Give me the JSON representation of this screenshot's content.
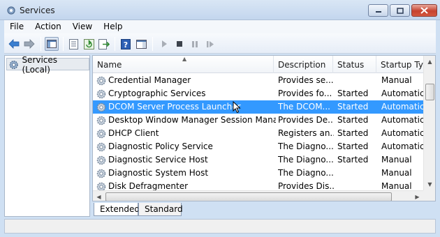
{
  "window": {
    "title": "Services"
  },
  "menu": [
    "File",
    "Action",
    "View",
    "Help"
  ],
  "tree": {
    "root_label": "Services (Local)"
  },
  "table": {
    "columns": [
      "Name",
      "Description",
      "Status",
      "Startup Typ"
    ],
    "rows": [
      {
        "name": "Credential Manager",
        "description": "Provides se...",
        "status": "",
        "startup": "Manual",
        "selected": false
      },
      {
        "name": "Cryptographic Services",
        "description": "Provides fo...",
        "status": "Started",
        "startup": "Automatic",
        "selected": false
      },
      {
        "name": "DCOM Server Process Launcher",
        "description": "The DCOM...",
        "status": "Started",
        "startup": "Automatic",
        "selected": true
      },
      {
        "name": "Desktop Window Manager Session Manager",
        "description": "Provides De...",
        "status": "Started",
        "startup": "Automatic",
        "selected": false
      },
      {
        "name": "DHCP Client",
        "description": "Registers an...",
        "status": "Started",
        "startup": "Automatic",
        "selected": false
      },
      {
        "name": "Diagnostic Policy Service",
        "description": "The Diagno...",
        "status": "Started",
        "startup": "Automatic",
        "selected": false
      },
      {
        "name": "Diagnostic Service Host",
        "description": "The Diagno...",
        "status": "Started",
        "startup": "Manual",
        "selected": false
      },
      {
        "name": "Diagnostic System Host",
        "description": "The Diagno...",
        "status": "",
        "startup": "Manual",
        "selected": false
      },
      {
        "name": "Disk Defragmenter",
        "description": "Provides Dis...",
        "status": "",
        "startup": "Manual",
        "selected": false
      }
    ]
  },
  "tabs": [
    "Extended",
    "Standard"
  ],
  "colors": {
    "selection": "#3399ff",
    "chrome": "#cfe0f3"
  },
  "icons": [
    "services-gear-icon",
    "back-arrow-icon",
    "forward-arrow-icon",
    "console-tree-icon",
    "properties-icon",
    "refresh-icon",
    "export-list-icon",
    "help-icon",
    "show-hide-pane-icon",
    "play-icon",
    "stop-icon",
    "pause-icon",
    "restart-icon"
  ]
}
